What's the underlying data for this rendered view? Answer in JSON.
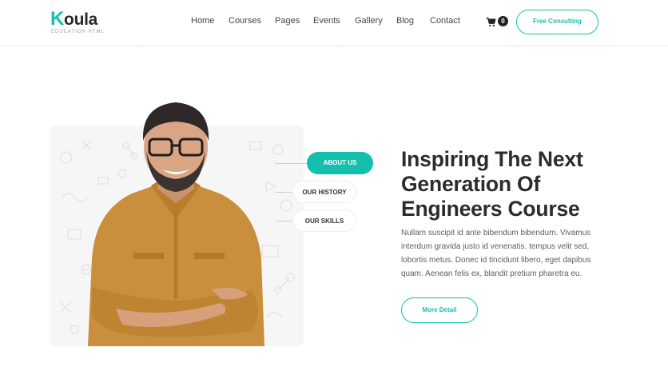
{
  "brand": {
    "name_first_letter": "K",
    "name_rest": "oula",
    "tagline": "EDUCATION HTML",
    "accent_color": "#15bfae"
  },
  "nav": {
    "items": [
      "Home",
      "Courses",
      "Pages",
      "Events",
      "Gallery",
      "Blog",
      "Contact"
    ]
  },
  "cart": {
    "icon": "shopping-cart-icon",
    "count": "0"
  },
  "header_cta": "Free Consulting",
  "tabs": {
    "items": [
      {
        "label": "ABOUT US",
        "active": true
      },
      {
        "label": "OUR HISTORY",
        "active": false
      },
      {
        "label": "OUR SKILLS",
        "active": false
      }
    ]
  },
  "hero": {
    "title_lines": [
      "Inspiring The Next",
      "Generation Of",
      "Engineers Course"
    ],
    "description": "Nullam suscipit id ante bibendum bibendum. Vivamus interdum gravida justo id venenatis. tempus velit sed, lobortis metus. Donec id tincidunt libero, eget dapibus quam. Aenean felis ex, blandit pretium pharetra eu.",
    "button_label": "More Detail"
  }
}
